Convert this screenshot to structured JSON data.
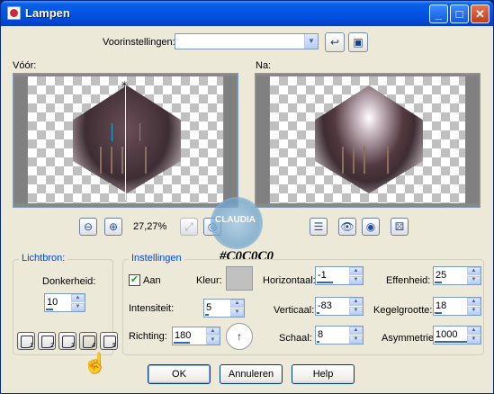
{
  "window": {
    "title": "Lampen"
  },
  "presets": {
    "label": "Voorinstellingen:",
    "value": ""
  },
  "preview": {
    "before_label": "Vóór:",
    "after_label": "Na:",
    "zoom_level": "27,27%"
  },
  "watermark": {
    "text": "CLAUDIA"
  },
  "annotation": {
    "color_code": "#C0C0C0"
  },
  "lightsource": {
    "title": "Lichtbron:",
    "darkness_label": "Donkerheid:",
    "darkness_value": "10",
    "lamp_buttons": [
      "1",
      "2",
      "3",
      "4",
      "5"
    ]
  },
  "settings": {
    "title": "Instellingen",
    "on_label": "Aan",
    "on_checked": true,
    "color_label": "Kleur:",
    "color_value": "#C0C0C0",
    "intensity_label": "Intensiteit:",
    "intensity_value": "5",
    "direction_label": "Richting:",
    "direction_value": "180",
    "horizontal_label": "Horizontaal:",
    "horizontal_value": "-1",
    "vertical_label": "Verticaal:",
    "vertical_value": "-83",
    "scale_label": "Schaal:",
    "scale_value": "8",
    "softness_label": "Effenheid:",
    "softness_value": "25",
    "cone_label": "Kegelgrootte:",
    "cone_value": "18",
    "asymmetry_label": "Asymmetrie:",
    "asymmetry_value": "1000"
  },
  "buttons": {
    "ok": "OK",
    "cancel": "Annuleren",
    "help": "Help"
  },
  "icons": {
    "title": "window-icon",
    "minimize": "minimize-icon",
    "maximize": "maximize-icon",
    "close": "close-icon"
  }
}
